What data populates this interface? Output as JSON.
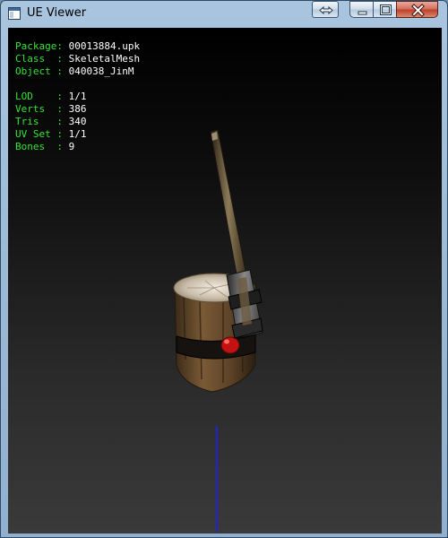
{
  "window": {
    "title": "UE Viewer"
  },
  "info": {
    "package": {
      "label": "Package:",
      "value": "00013884.upk"
    },
    "class": {
      "label": "Class  :",
      "value": "SkeletalMesh"
    },
    "object": {
      "label": "Object :",
      "value": "040038_JinM"
    },
    "lod": {
      "label": "LOD    :",
      "value": "1/1"
    },
    "verts": {
      "label": "Verts  :",
      "value": "386"
    },
    "tris": {
      "label": "Tris   :",
      "value": "340"
    },
    "uvset": {
      "label": "UV Set :",
      "value": "1/1"
    },
    "bones": {
      "label": "Bones  :",
      "value": "9"
    }
  },
  "colors": {
    "info_label": "#33e633",
    "info_value": "#ffffff",
    "axis": "#1c24d8",
    "close": "#c0402b"
  }
}
